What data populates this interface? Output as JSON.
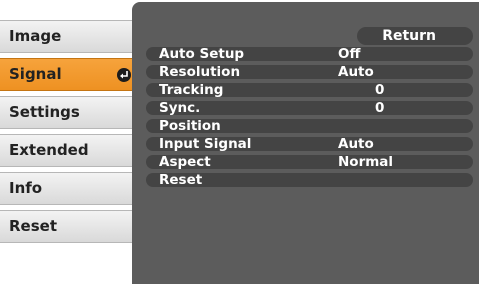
{
  "menu": {
    "items": [
      {
        "label": "Image",
        "selected": false
      },
      {
        "label": "Signal",
        "selected": true
      },
      {
        "label": "Settings",
        "selected": false
      },
      {
        "label": "Extended",
        "selected": false
      },
      {
        "label": "Info",
        "selected": false
      },
      {
        "label": "Reset",
        "selected": false
      }
    ],
    "selected_icon": "enter-icon"
  },
  "panel": {
    "return_label": "Return",
    "rows": [
      {
        "label": "Auto Setup",
        "value": "Off"
      },
      {
        "label": "Resolution",
        "value": "Auto"
      },
      {
        "label": "Tracking",
        "value": "0"
      },
      {
        "label": "Sync.",
        "value": "0"
      },
      {
        "label": "Position",
        "value": ""
      },
      {
        "label": "Input Signal",
        "value": "Auto"
      },
      {
        "label": "Aspect",
        "value": "Normal"
      },
      {
        "label": "Reset",
        "value": ""
      }
    ]
  },
  "colors": {
    "menu_selected": "#f29a2e",
    "menu_default": "#e6e6e6",
    "panel_bg": "#5c5c5c",
    "row_bg": "#444444",
    "text_light": "#ffffff"
  }
}
